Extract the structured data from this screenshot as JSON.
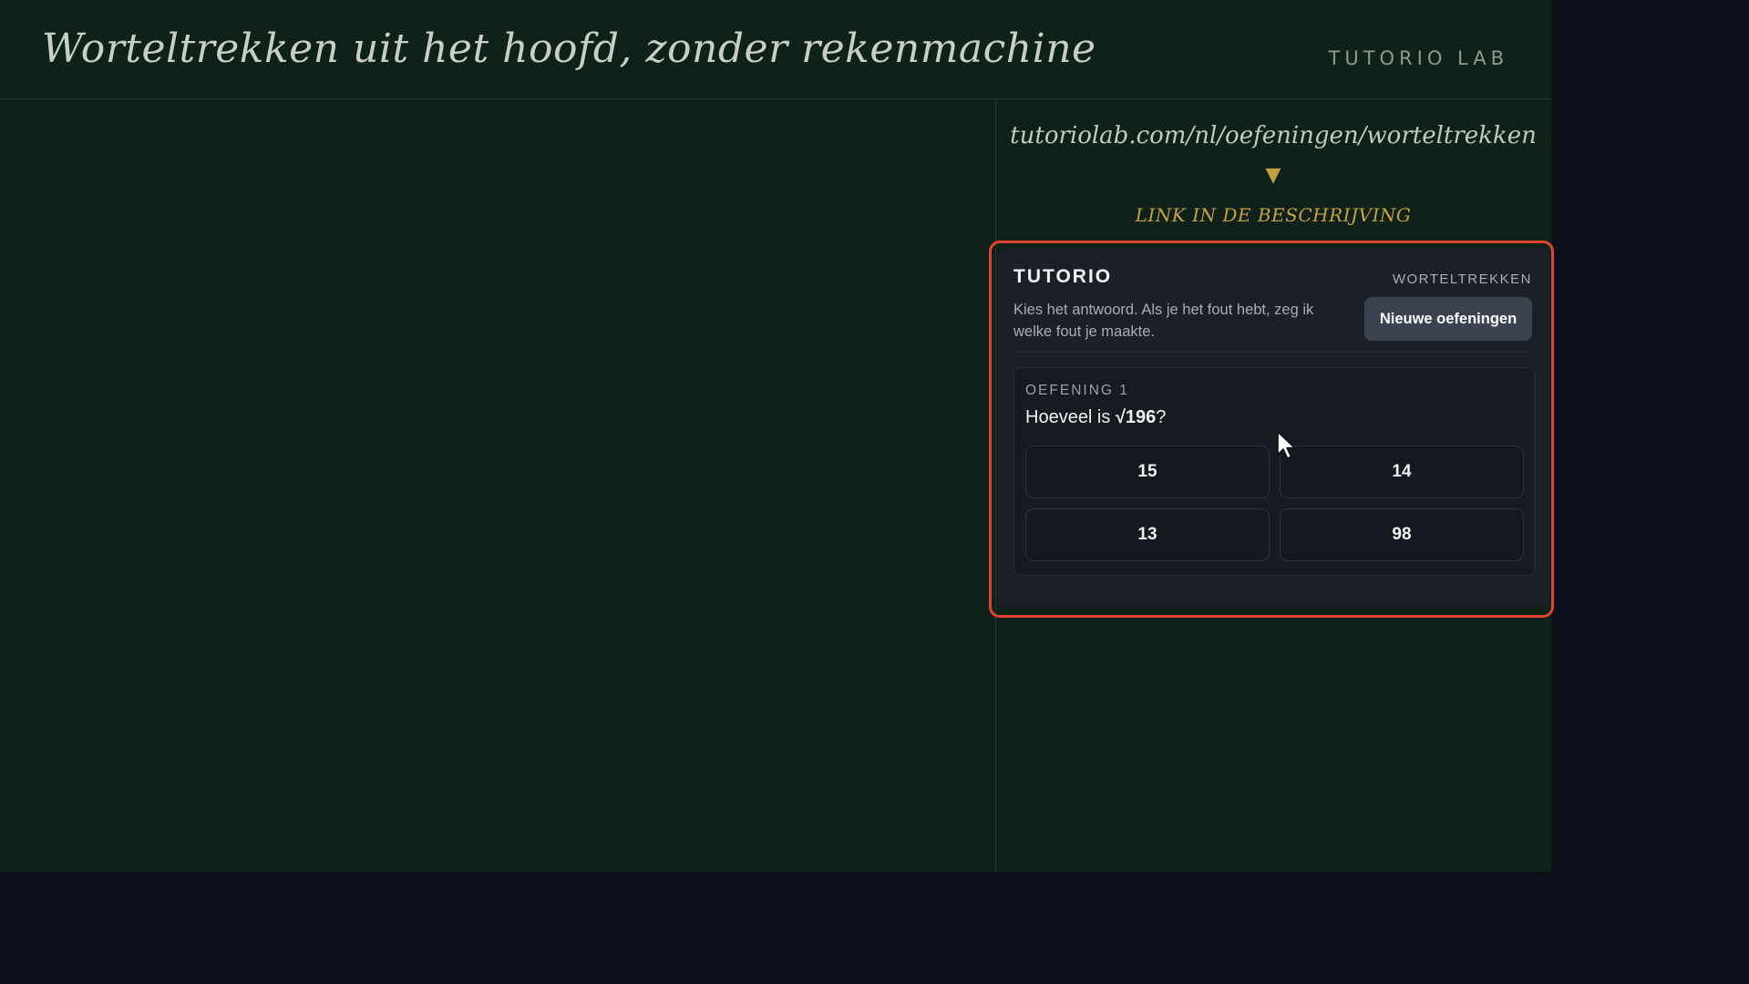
{
  "header": {
    "title": "Worteltrekken uit het hoofd, zonder rekenmachine",
    "brand": "TUTORIO LAB"
  },
  "promo": {
    "url": "tutoriolab.com/nl/oefeningen/worteltrekken",
    "arrow": "▼",
    "note": "LINK IN DE BESCHRIJVING"
  },
  "widget": {
    "brand": "TUTORIO",
    "topic": "WORTELTREKKEN",
    "description": "Kies het antwoord. Als je het fout hebt, zeg ik welke fout je maakte.",
    "new_button": "Nieuwe oefeningen",
    "exercise": {
      "label": "OEFENING 1",
      "question_prefix": "Hoeveel is ",
      "question_expression": "√196",
      "question_suffix": "?",
      "options": [
        "15",
        "14",
        "13",
        "98"
      ]
    }
  },
  "colors": {
    "background": "#0f2219",
    "outer": "#0b0f1a",
    "accent_gold": "#c9a13f",
    "highlight_red": "#e2432f",
    "widget_bg": "#1b1f27"
  },
  "icons": {
    "cursor": "mouse-pointer-icon",
    "arrow": "arrow-down-icon"
  }
}
